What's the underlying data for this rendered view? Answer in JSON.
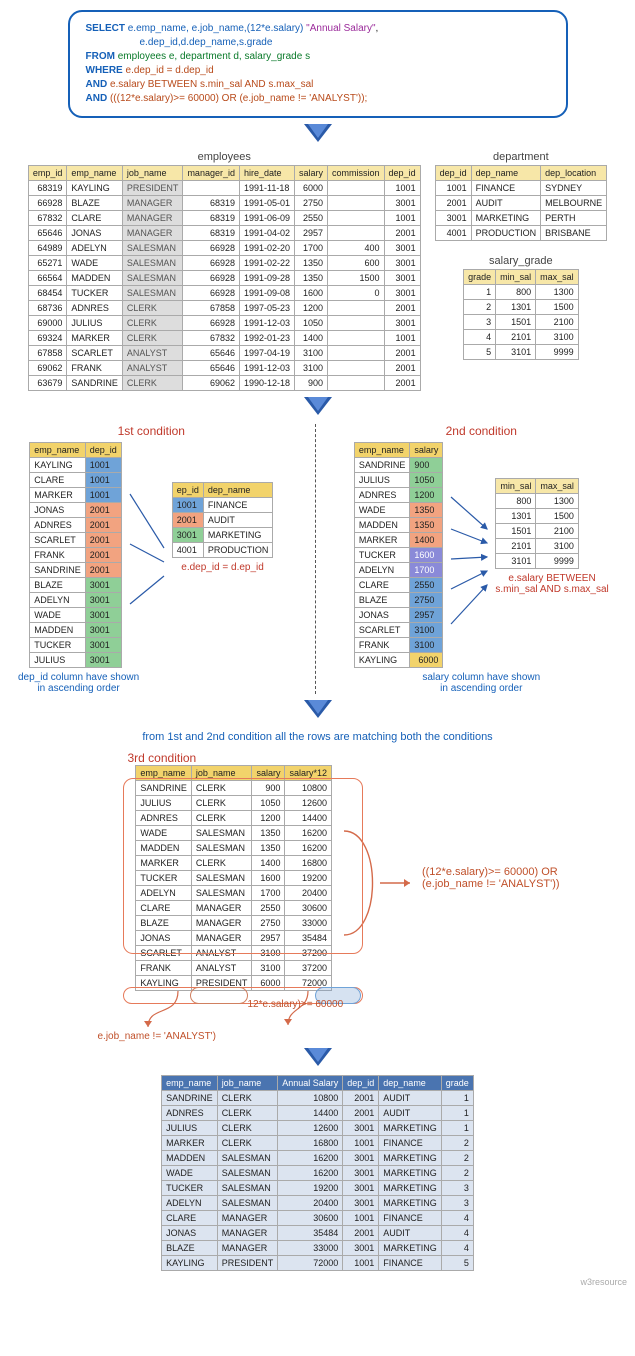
{
  "sql": {
    "line1_select": "SELECT",
    "line1_cols": "e.emp_name, e.job_name,(12*e.salary)",
    "line1_str": "\"Annual Salary\"",
    "line1_tail": ",",
    "line2_cols": "e.dep_id,d.dep_name,s.grade",
    "line3_from": "FROM",
    "line3_tbl": "employees e, department d, salary_grade s",
    "line4_where": "WHERE",
    "line4_cond": "e.dep_id = d.dep_id",
    "line5_and": "AND",
    "line5_cond1": "e.salary  BETWEEN",
    "line5_cond2": "s.min_sal AND s.max_sal",
    "line6_and": "AND",
    "line6_cond": "(((12*e.salary)>= 60000)  OR (e.job_name != 'ANALYST'));"
  },
  "titles": {
    "employees": "employees",
    "department": "department",
    "salary_grade": "salary_grade",
    "cond1": "1st condition",
    "cond2": "2nd condition",
    "cond3": "3rd condition"
  },
  "employees": {
    "headers": [
      "emp_id",
      "emp_name",
      "job_name",
      "manager_id",
      "hire_date",
      "salary",
      "commission",
      "dep_id"
    ],
    "rows": [
      [
        "68319",
        "KAYLING",
        "PRESIDENT",
        "",
        "1991-11-18",
        "6000",
        "",
        "1001"
      ],
      [
        "66928",
        "BLAZE",
        "MANAGER",
        "68319",
        "1991-05-01",
        "2750",
        "",
        "3001"
      ],
      [
        "67832",
        "CLARE",
        "MANAGER",
        "68319",
        "1991-06-09",
        "2550",
        "",
        "1001"
      ],
      [
        "65646",
        "JONAS",
        "MANAGER",
        "68319",
        "1991-04-02",
        "2957",
        "",
        "2001"
      ],
      [
        "64989",
        "ADELYN",
        "SALESMAN",
        "66928",
        "1991-02-20",
        "1700",
        "400",
        "3001"
      ],
      [
        "65271",
        "WADE",
        "SALESMAN",
        "66928",
        "1991-02-22",
        "1350",
        "600",
        "3001"
      ],
      [
        "66564",
        "MADDEN",
        "SALESMAN",
        "66928",
        "1991-09-28",
        "1350",
        "1500",
        "3001"
      ],
      [
        "68454",
        "TUCKER",
        "SALESMAN",
        "66928",
        "1991-09-08",
        "1600",
        "0",
        "3001"
      ],
      [
        "68736",
        "ADNRES",
        "CLERK",
        "67858",
        "1997-05-23",
        "1200",
        "",
        "2001"
      ],
      [
        "69000",
        "JULIUS",
        "CLERK",
        "66928",
        "1991-12-03",
        "1050",
        "",
        "3001"
      ],
      [
        "69324",
        "MARKER",
        "CLERK",
        "67832",
        "1992-01-23",
        "1400",
        "",
        "1001"
      ],
      [
        "67858",
        "SCARLET",
        "ANALYST",
        "65646",
        "1997-04-19",
        "3100",
        "",
        "2001"
      ],
      [
        "69062",
        "FRANK",
        "ANALYST",
        "65646",
        "1991-12-03",
        "3100",
        "",
        "2001"
      ],
      [
        "63679",
        "SANDRINE",
        "CLERK",
        "69062",
        "1990-12-18",
        "900",
        "",
        "2001"
      ]
    ]
  },
  "department": {
    "headers": [
      "dep_id",
      "dep_name",
      "dep_location"
    ],
    "rows": [
      [
        "1001",
        "FINANCE",
        "SYDNEY"
      ],
      [
        "2001",
        "AUDIT",
        "MELBOURNE"
      ],
      [
        "3001",
        "MARKETING",
        "PERTH"
      ],
      [
        "4001",
        "PRODUCTION",
        "BRISBANE"
      ]
    ]
  },
  "salary_grade": {
    "headers": [
      "grade",
      "min_sal",
      "max_sal"
    ],
    "rows": [
      [
        "1",
        "800",
        "1300"
      ],
      [
        "2",
        "1301",
        "1500"
      ],
      [
        "3",
        "1501",
        "2100"
      ],
      [
        "4",
        "2101",
        "3100"
      ],
      [
        "5",
        "3101",
        "9999"
      ]
    ]
  },
  "cond1_left": {
    "headers": [
      "emp_name",
      "dep_id"
    ],
    "rows": [
      [
        "KAYLING",
        "1001",
        "blue"
      ],
      [
        "CLARE",
        "1001",
        "blue"
      ],
      [
        "MARKER",
        "1001",
        "blue"
      ],
      [
        "JONAS",
        "2001",
        "orange"
      ],
      [
        "ADNRES",
        "2001",
        "orange"
      ],
      [
        "SCARLET",
        "2001",
        "orange"
      ],
      [
        "FRANK",
        "2001",
        "orange"
      ],
      [
        "SANDRINE",
        "2001",
        "orange"
      ],
      [
        "BLAZE",
        "3001",
        "green"
      ],
      [
        "ADELYN",
        "3001",
        "green"
      ],
      [
        "WADE",
        "3001",
        "green"
      ],
      [
        "MADDEN",
        "3001",
        "green"
      ],
      [
        "TUCKER",
        "3001",
        "green"
      ],
      [
        "JULIUS",
        "3001",
        "green"
      ]
    ]
  },
  "cond1_right": {
    "headers": [
      "ep_id",
      "dep_name"
    ],
    "rows": [
      [
        "1001",
        "FINANCE",
        "blue"
      ],
      [
        "2001",
        "AUDIT",
        "orange"
      ],
      [
        "3001",
        "MARKETING",
        "green"
      ],
      [
        "4001",
        "PRODUCTION",
        ""
      ]
    ]
  },
  "cond1_join": "e.dep_id = d.ep_id",
  "cond1_caption": "dep_id column have shown\nin ascending order",
  "cond2_left": {
    "headers": [
      "emp_name",
      "salary"
    ],
    "rows": [
      [
        "SANDRINE",
        "900",
        "green"
      ],
      [
        "JULIUS",
        "1050",
        "green"
      ],
      [
        "ADNRES",
        "1200",
        "green"
      ],
      [
        "WADE",
        "1350",
        "orange"
      ],
      [
        "MADDEN",
        "1350",
        "orange"
      ],
      [
        "MARKER",
        "1400",
        "orange"
      ],
      [
        "TUCKER",
        "1600",
        "violet"
      ],
      [
        "ADELYN",
        "1700",
        "violet"
      ],
      [
        "CLARE",
        "2550",
        "blue"
      ],
      [
        "BLAZE",
        "2750",
        "blue"
      ],
      [
        "JONAS",
        "2957",
        "blue"
      ],
      [
        "SCARLET",
        "3100",
        "blue"
      ],
      [
        "FRANK",
        "3100",
        "blue"
      ],
      [
        "KAYLING",
        "6000",
        "yellow"
      ]
    ]
  },
  "cond2_right": {
    "headers": [
      "min_sal",
      "max_sal"
    ],
    "rows": [
      [
        "800",
        "1300"
      ],
      [
        "1301",
        "1500"
      ],
      [
        "1501",
        "2100"
      ],
      [
        "2101",
        "3100"
      ],
      [
        "3101",
        "9999"
      ]
    ]
  },
  "cond2_join": "e.salary  BETWEEN\ns.min_sal AND s.max_sal",
  "cond2_caption": "salary column have shown\nin ascending order",
  "mid_text": "from 1st and 2nd condition all the rows are matching both the conditions",
  "cond3": {
    "headers": [
      "emp_name",
      "job_name",
      "salary",
      "salary*12"
    ],
    "rows": [
      [
        "SANDRINE",
        "CLERK",
        "900",
        "10800"
      ],
      [
        "JULIUS",
        "CLERK",
        "1050",
        "12600"
      ],
      [
        "ADNRES",
        "CLERK",
        "1200",
        "14400"
      ],
      [
        "WADE",
        "SALESMAN",
        "1350",
        "16200"
      ],
      [
        "MADDEN",
        "SALESMAN",
        "1350",
        "16200"
      ],
      [
        "MARKER",
        "CLERK",
        "1400",
        "16800"
      ],
      [
        "TUCKER",
        "SALESMAN",
        "1600",
        "19200"
      ],
      [
        "ADELYN",
        "SALESMAN",
        "1700",
        "20400"
      ],
      [
        "CLARE",
        "MANAGER",
        "2550",
        "30600"
      ],
      [
        "BLAZE",
        "MANAGER",
        "2750",
        "33000"
      ],
      [
        "JONAS",
        "MANAGER",
        "2957",
        "35484"
      ],
      [
        "SCARLET",
        "ANALYST",
        "3100",
        "37200"
      ],
      [
        "FRANK",
        "ANALYST",
        "3100",
        "37200"
      ],
      [
        "KAYLING",
        "PRESIDENT",
        "6000",
        "72000"
      ]
    ]
  },
  "cond3_expr": "((12*e.salary)>= 60000)  OR\n(e.job_name != 'ANALYST'))",
  "cond3_sub1": "12*e.salary)>= 60000",
  "cond3_sub2": "e.job_name != 'ANALYST')",
  "result": {
    "headers": [
      "emp_name",
      "job_name",
      "Annual Salary",
      "dep_id",
      "dep_name",
      "grade"
    ],
    "rows": [
      [
        "SANDRINE",
        "CLERK",
        "10800",
        "2001",
        "AUDIT",
        "1"
      ],
      [
        "ADNRES",
        "CLERK",
        "14400",
        "2001",
        "AUDIT",
        "1"
      ],
      [
        "JULIUS",
        "CLERK",
        "12600",
        "3001",
        "MARKETING",
        "1"
      ],
      [
        "MARKER",
        "CLERK",
        "16800",
        "1001",
        "FINANCE",
        "2"
      ],
      [
        "MADDEN",
        "SALESMAN",
        "16200",
        "3001",
        "MARKETING",
        "2"
      ],
      [
        "WADE",
        "SALESMAN",
        "16200",
        "3001",
        "MARKETING",
        "2"
      ],
      [
        "TUCKER",
        "SALESMAN",
        "19200",
        "3001",
        "MARKETING",
        "3"
      ],
      [
        "ADELYN",
        "SALESMAN",
        "20400",
        "3001",
        "MARKETING",
        "3"
      ],
      [
        "CLARE",
        "MANAGER",
        "30600",
        "1001",
        "FINANCE",
        "4"
      ],
      [
        "JONAS",
        "MANAGER",
        "35484",
        "2001",
        "AUDIT",
        "4"
      ],
      [
        "BLAZE",
        "MANAGER",
        "33000",
        "3001",
        "MARKETING",
        "4"
      ],
      [
        "KAYLING",
        "PRESIDENT",
        "72000",
        "1001",
        "FINANCE",
        "5"
      ]
    ]
  },
  "watermark": "w3resource"
}
